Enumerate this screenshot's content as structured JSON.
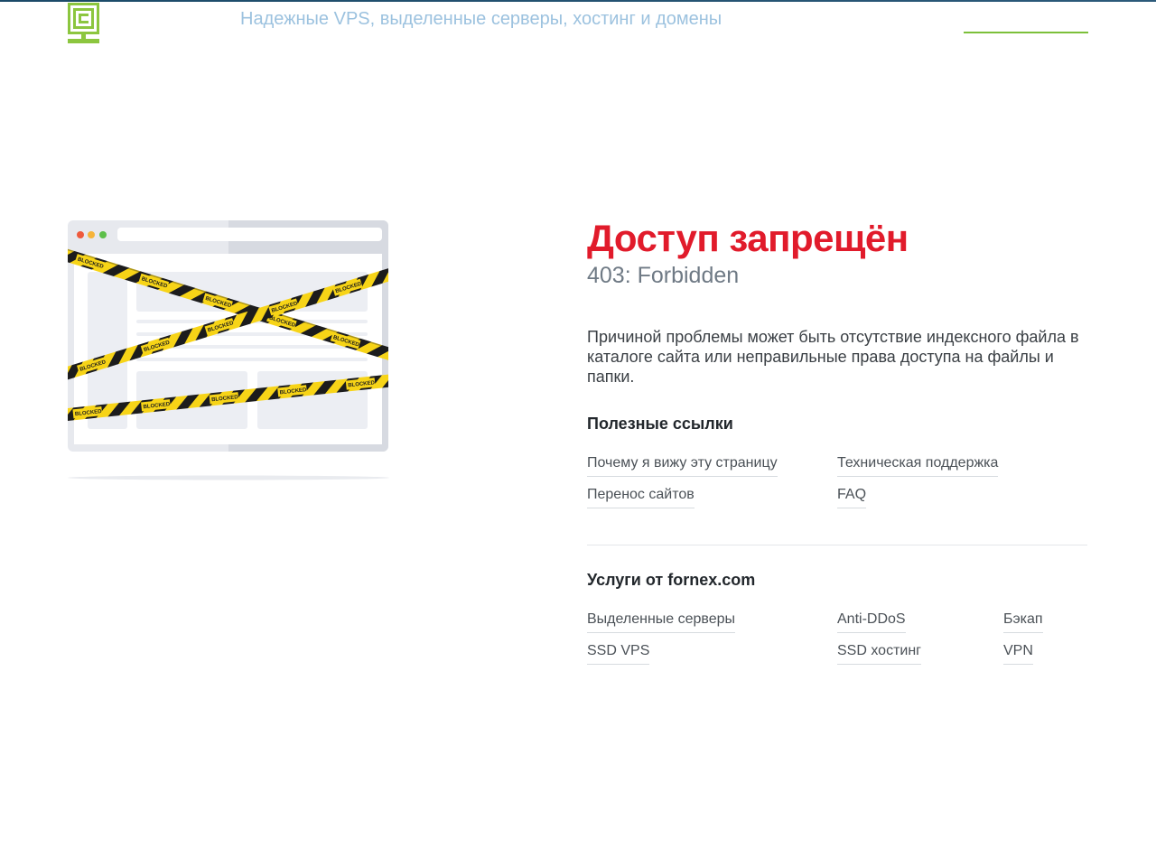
{
  "header": {
    "tagline": "Надежные VPS, выделенные серверы, хостинг и домены"
  },
  "illustration": {
    "tape_text": "BLOCKED"
  },
  "error": {
    "title": "Доступ запрещён",
    "subtitle": "403: Forbidden",
    "description": "Причиной проблемы может быть отсутствие индексного файла в каталоге сайта или неправильные права доступа на файлы и папки."
  },
  "useful_links": {
    "title": "Полезные ссылки",
    "items": [
      "Почему я вижу эту страницу",
      "Техническая поддержка",
      "Перенос сайтов",
      "FAQ"
    ]
  },
  "services": {
    "title": "Услуги от fornex.com",
    "items": [
      "Выделенные серверы",
      "Anti-DDoS",
      "Бэкап",
      "SSD VPS",
      "SSD хостинг",
      "VPN"
    ]
  },
  "colors": {
    "accent_red": "#e11b2b",
    "brand_green": "#7cc03a",
    "tape_yellow": "#f7d417",
    "tagline_blue": "#9cc2df"
  }
}
